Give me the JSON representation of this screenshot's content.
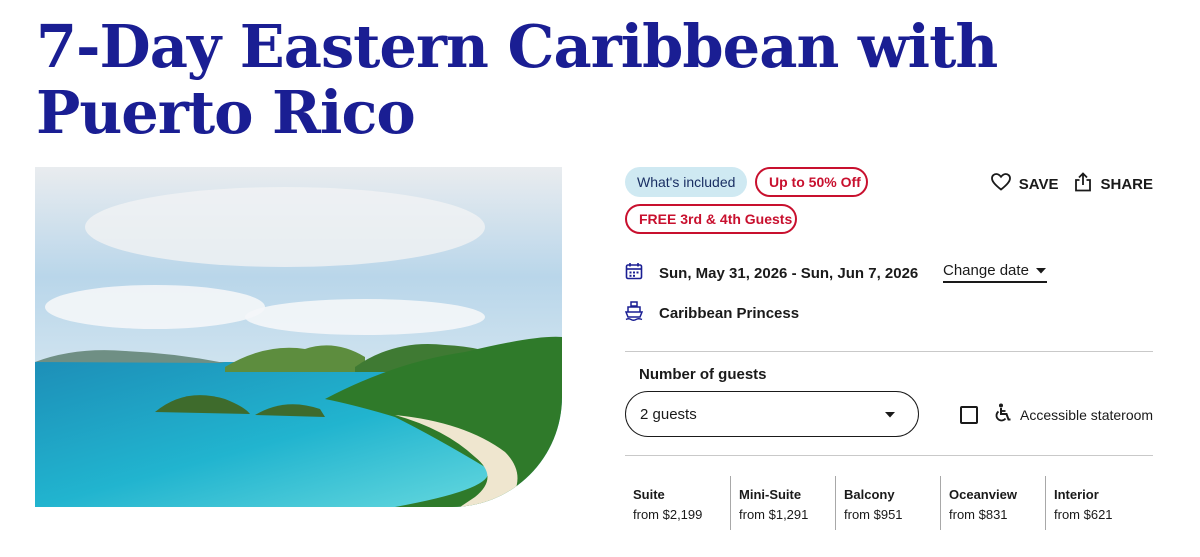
{
  "title": "7-Day Eastern Caribbean with Puerto Rico",
  "badges": {
    "included": "What's included",
    "offer": "Up to 50% Off",
    "guests_offer": "FREE 3rd & 4th Guests"
  },
  "actions": {
    "save": "SAVE",
    "share": "SHARE"
  },
  "sailing": {
    "dates": "Sun, May 31, 2026 - Sun, Jun 7, 2026",
    "change_date": "Change date",
    "ship": "Caribbean Princess"
  },
  "guests": {
    "label": "Number of guests",
    "selected": "2 guests",
    "accessible_label": "Accessible stateroom"
  },
  "cabins": [
    {
      "name": "Suite",
      "price": "from $2,199"
    },
    {
      "name": "Mini-Suite",
      "price": "from $1,291"
    },
    {
      "name": "Balcony",
      "price": "from $951"
    },
    {
      "name": "Oceanview",
      "price": "from $831"
    },
    {
      "name": "Interior",
      "price": "from $621"
    }
  ],
  "colors": {
    "brand_navy": "#1a1e93",
    "offer_red": "#c8102e",
    "included_bg": "#cfe9f2"
  },
  "icons": [
    "heart-icon",
    "share-icon",
    "calendar-icon",
    "ship-icon",
    "chevron-down-icon",
    "wheelchair-icon"
  ]
}
